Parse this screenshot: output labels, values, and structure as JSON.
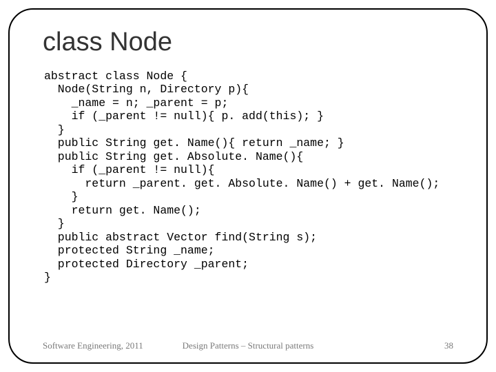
{
  "title": "class Node",
  "code": "abstract class Node {\n  Node(String n, Directory p){\n    _name = n; _parent = p;\n    if (_parent != null){ p. add(this); }\n  }\n  public String get. Name(){ return _name; }\n  public String get. Absolute. Name(){\n    if (_parent != null){\n      return _parent. get. Absolute. Name() + get. Name();\n    }\n    return get. Name();\n  }\n  public abstract Vector find(String s);\n  protected String _name;\n  protected Directory _parent;\n}",
  "footer": {
    "left": "Software Engineering, 2011",
    "center": "Design Patterns – Structural patterns",
    "right": "38"
  }
}
